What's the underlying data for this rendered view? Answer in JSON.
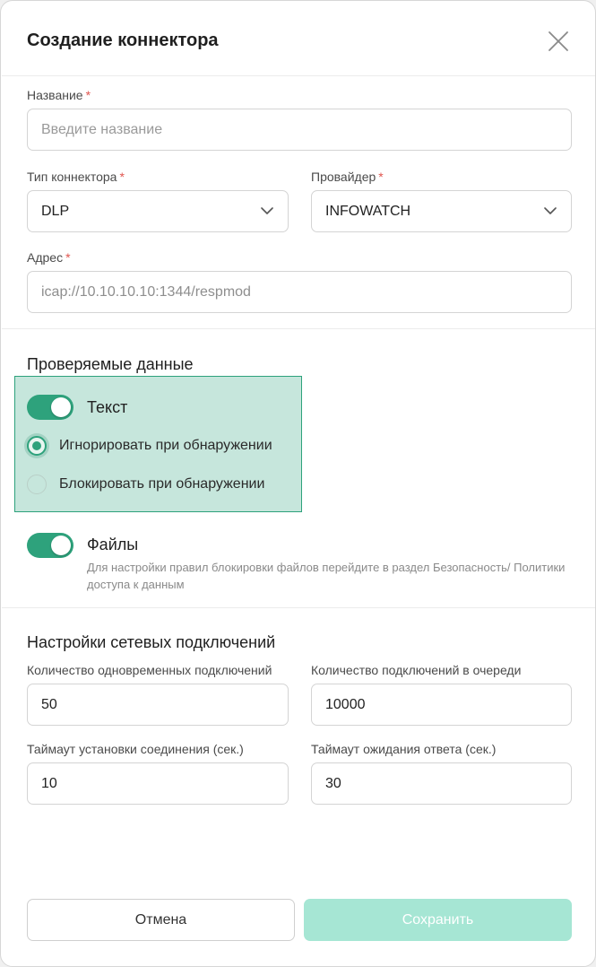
{
  "dialog": {
    "title": "Создание коннектора"
  },
  "form": {
    "name": {
      "label": "Название",
      "required": "*",
      "value": "",
      "placeholder": "Введите название"
    },
    "connector_type": {
      "label": "Тип коннектора",
      "required": "*",
      "value": "DLP"
    },
    "provider": {
      "label": "Провайдер",
      "required": "*",
      "value": "INFOWATCH"
    },
    "address": {
      "label": "Адрес",
      "required": "*",
      "value": "icap://10.10.10.10:1344/respmod"
    }
  },
  "checked_data": {
    "title": "Проверяемые данные",
    "text_toggle": {
      "label": "Текст",
      "on": true
    },
    "radio_options": [
      {
        "label": "Игнорировать при обнаружении",
        "checked": true
      },
      {
        "label": "Блокировать при обнаружении",
        "checked": false
      }
    ],
    "files_toggle": {
      "label": "Файлы",
      "on": true,
      "hint": "Для настройки правил блокировки файлов перейдите в раздел Безопасность/ Политики доступа к данным"
    }
  },
  "network": {
    "title": "Настройки сетевых подключений",
    "concurrent": {
      "label": "Количество одновременных подключений",
      "value": "50"
    },
    "queue": {
      "label": "Количество подключений в очереди",
      "value": "10000"
    },
    "connect_timeout": {
      "label": "Таймаут установки соединения (сек.)",
      "value": "10"
    },
    "response_timeout": {
      "label": "Таймаут ожидания ответа (сек.)",
      "value": "30"
    }
  },
  "buttons": {
    "cancel": "Отмена",
    "save": "Сохранить"
  },
  "colors": {
    "accent": "#2ea27c",
    "highlight_bg": "#c6e6dc",
    "save_disabled": "#a6e6d4",
    "required": "#e0554f"
  },
  "icons": {
    "close": "close-icon",
    "chevron": "chevron-down-icon"
  }
}
